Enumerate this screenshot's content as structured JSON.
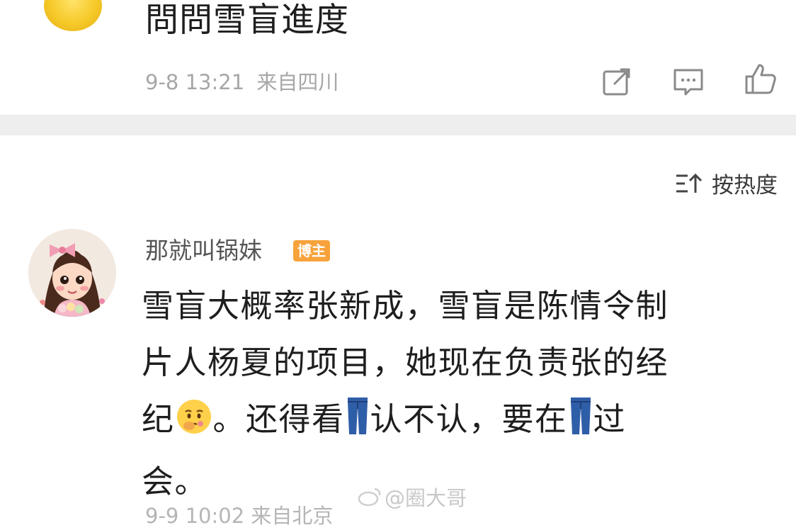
{
  "top_comment": {
    "text": "問問雪盲進度",
    "time": "9-8 13:21",
    "location": "来自四川"
  },
  "sort": {
    "label": "按热度"
  },
  "comment": {
    "username": "那就叫锅妹",
    "badge": "博主",
    "line1": "雪盲大概率张新成，雪盲是陈情令制",
    "line2": "片人杨夏的项目，她现在负责张的经",
    "line3_a": "纪",
    "line3_b": "。还得看",
    "line3_c": "认不认，要在",
    "line3_d": "过",
    "line4": "会。",
    "meta_partial": "9-9 10:02  来自北京"
  },
  "watermark": {
    "text": "@圈大哥"
  },
  "icons": {
    "share": "share-icon",
    "comment": "comment-icon",
    "like": "thumbs-up-icon",
    "sort": "sort-icon",
    "emoji_thinking": "thinking-face-emoji",
    "emoji_jeans": "jeans-emoji"
  },
  "colors": {
    "badge_bg": "#f7a23b",
    "meta_gray": "#a7a7a7",
    "divider": "#eeeeee"
  }
}
